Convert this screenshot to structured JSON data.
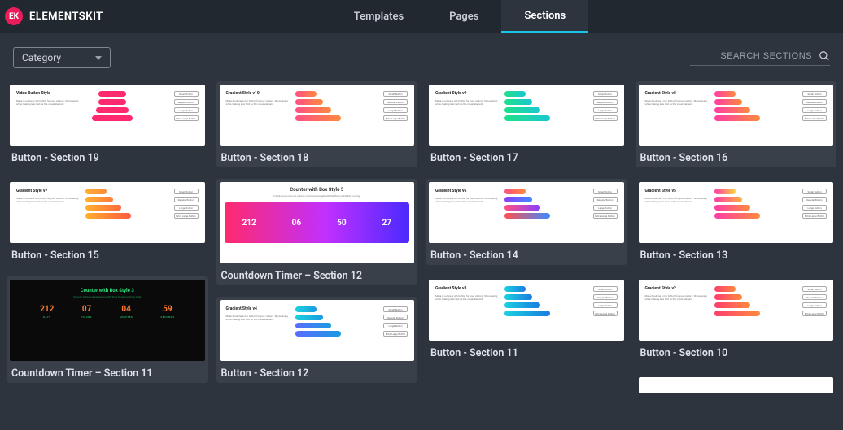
{
  "brand": {
    "logo_glyph": "EK",
    "name": "ELEMENTSKIT"
  },
  "nav": {
    "items": [
      {
        "label": "Templates",
        "active": false
      },
      {
        "label": "Pages",
        "active": false
      },
      {
        "label": "Sections",
        "active": true
      }
    ]
  },
  "toolbar": {
    "category_label": "Category",
    "search_placeholder": "SEARCH SECTIONS"
  },
  "thumb_text": {
    "video_button": "Video Button Style",
    "gradient_v10": "Gradient Style v10",
    "gradient_v9": "Gradient Style v9",
    "gradient_v8": "Gradient Style v8",
    "gradient_v7": "Gradient Style v7",
    "gradient_v6": "Gradient Style v6",
    "gradient_v5": "Gradient Style v5",
    "gradient_v4": "Gradient Style v4",
    "gradient_v3": "Gradient Style v3",
    "gradient_v2": "Gradient Style v2",
    "counter5": "Counter with Box Style 5",
    "counter5_sub": "Introducing our most potent countdown widget with the finest durability scoring",
    "counter3": "Counter with Box Style 3",
    "counter3_sub": "Uncover better use experience with thick background box style",
    "counter_values": [
      "212",
      "06",
      "50",
      "27"
    ],
    "dark_counter_values": [
      "212",
      "07",
      "04",
      "59"
    ],
    "dark_counter_labels": [
      "DAYS",
      "HOURS",
      "MINUTES",
      "SECONDS"
    ],
    "outline_labels": [
      "Small Button",
      "Regular Button",
      "Large Button",
      "Extra Large Button"
    ],
    "lorem_short": "Make it outline a rich button for your visitors. Showcasing while making less text as the visual element."
  },
  "cards": {
    "c19": "Button - Section 19",
    "c18": "Button - Section 18",
    "c17": "Button - Section 17",
    "c16": "Button - Section 16",
    "c15": "Button - Section 15",
    "c14": "Button - Section 14",
    "c13": "Button - Section 13",
    "c12t": "Countdown Timer – Section 12",
    "c12": "Button - Section 12",
    "c11t": "Countdown Timer – Section 11",
    "c11": "Button - Section 11",
    "c10": "Button - Section 10"
  }
}
